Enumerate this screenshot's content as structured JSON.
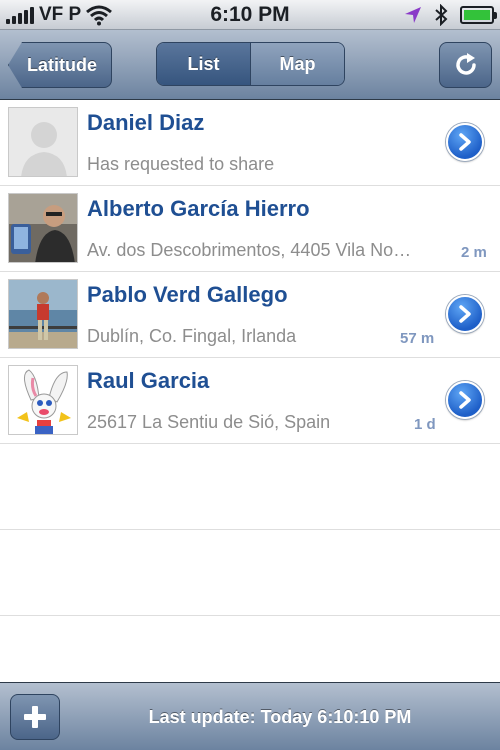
{
  "status_bar": {
    "carrier": "VF P",
    "time": "6:10 PM",
    "icons": [
      "signal-icon",
      "wifi-icon",
      "location-arrow-icon",
      "bluetooth-icon",
      "battery-icon"
    ]
  },
  "nav": {
    "back_label": "Latitude",
    "segments": [
      "List",
      "Map"
    ],
    "selected_segment": "List"
  },
  "friends": [
    {
      "name": "Daniel Diaz",
      "subtitle": "Has requested to share",
      "distance": ""
    },
    {
      "name": "Alberto García Hierro",
      "subtitle": "Av. dos Descobrimentos, 4405 Vila No…",
      "distance": "2 m"
    },
    {
      "name": "Pablo Verd Gallego",
      "subtitle": "Dublín, Co. Fingal, Irlanda",
      "distance": "57 m"
    },
    {
      "name": "Raul Garcia",
      "subtitle": "25617 La Sentiu de Sió, Spain",
      "distance": "1 d"
    }
  ],
  "toolbar": {
    "last_update": "Last update: Today 6:10:10 PM"
  },
  "colors": {
    "name_blue": "#1f4f93",
    "nav_gradient_top": "#b3bfcf",
    "nav_gradient_bottom": "#6c83a0",
    "battery_green": "#33c23a"
  }
}
